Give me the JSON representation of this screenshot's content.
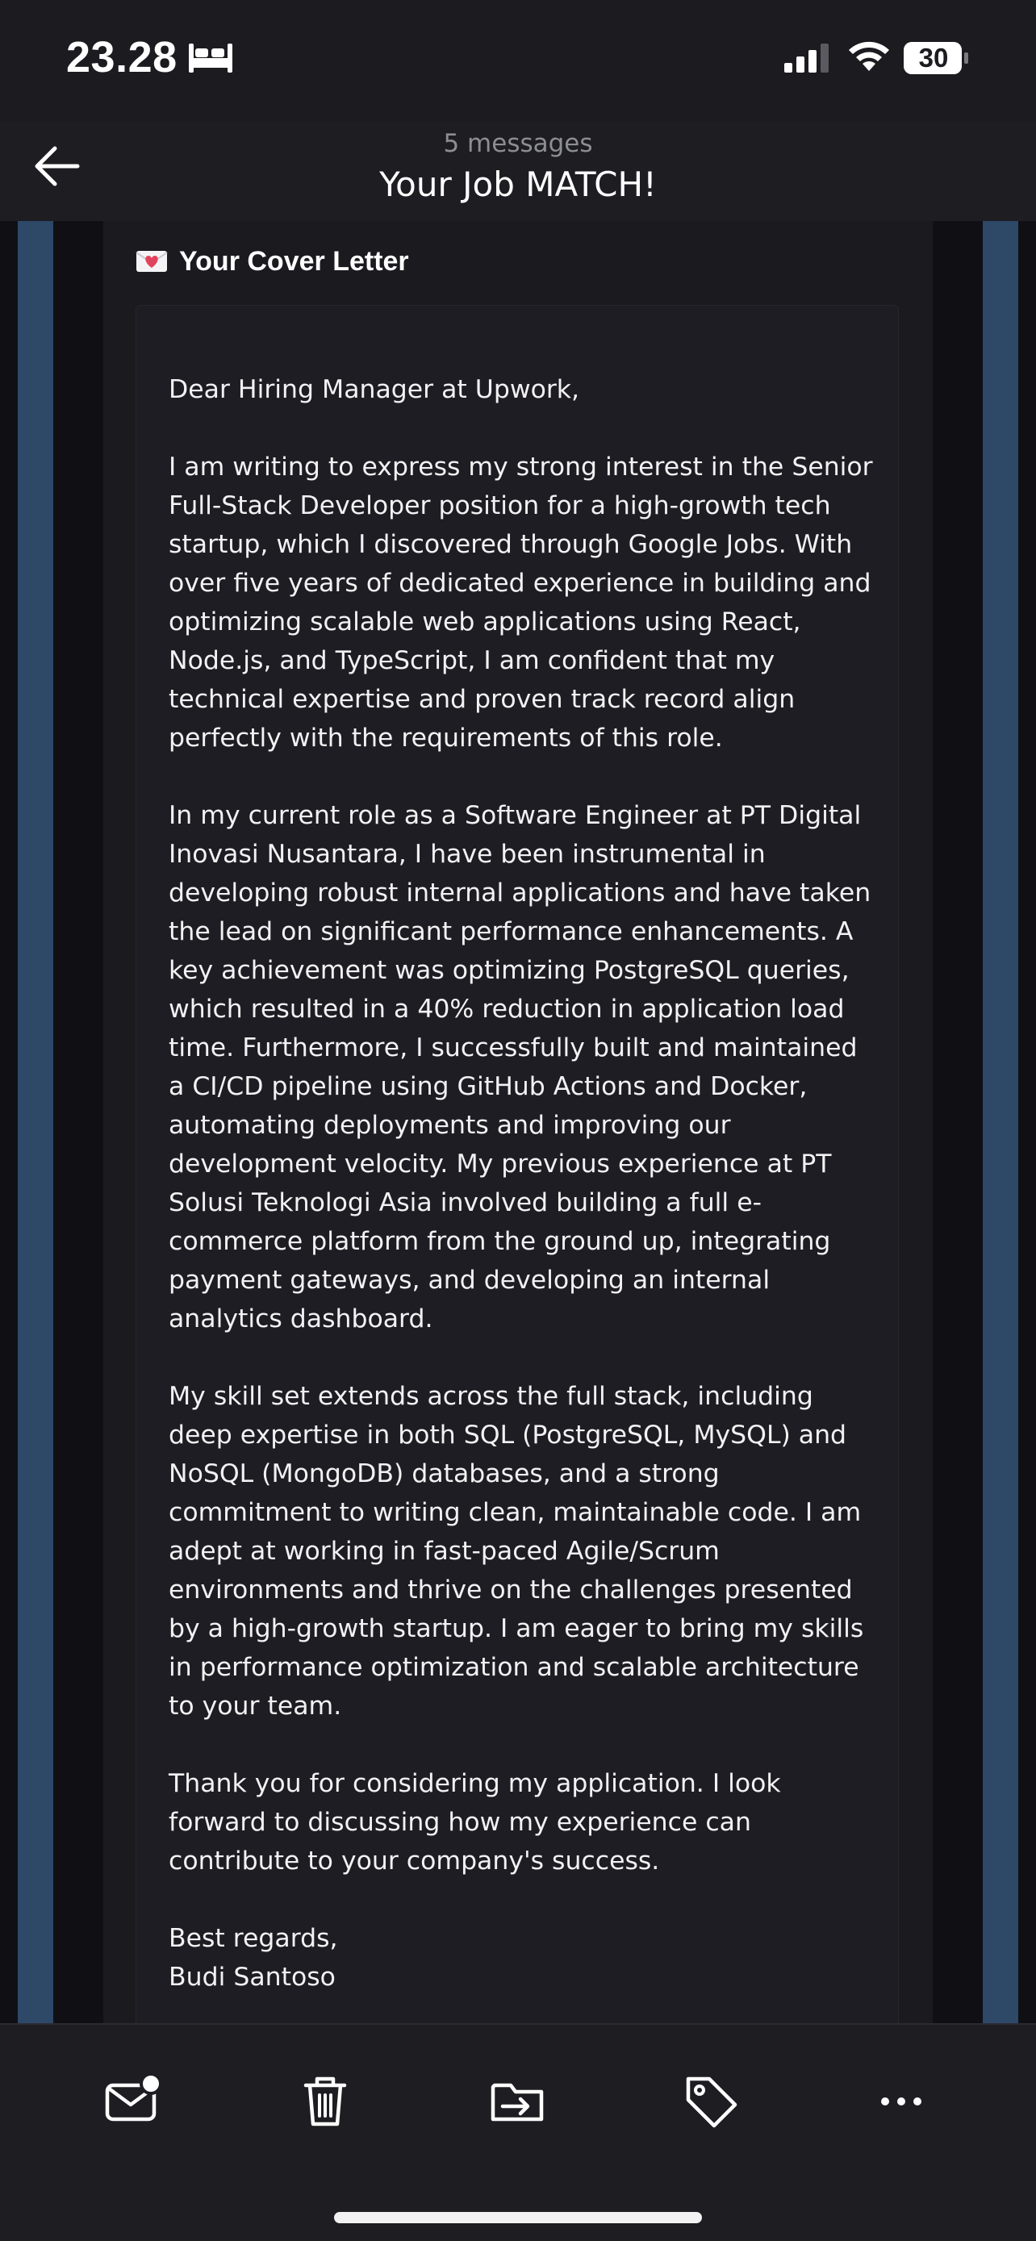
{
  "status_bar": {
    "time": "23.28",
    "battery_level": "30"
  },
  "header": {
    "message_count": "5 messages",
    "title": "Your Job MATCH!"
  },
  "email": {
    "section_heading": "Your Cover Letter",
    "letter_paragraphs": [
      "Dear Hiring Manager at Upwork,",
      "I am writing to express my strong interest in the Senior Full-Stack Developer position for a high-growth tech startup, which I discovered through Google Jobs. With over five years of dedicated experience in building and optimizing scalable web applications using React, Node.js, and TypeScript, I am confident that my technical expertise and proven track record align perfectly with the requirements of this role.",
      "In my current role as a Software Engineer at PT Digital Inovasi Nusantara, I have been instrumental in developing robust internal applications and have taken the lead on significant performance enhancements. A key achievement was optimizing PostgreSQL queries, which resulted in a 40% reduction in application load time. Furthermore, I successfully built and maintained a CI/CD pipeline using GitHub Actions and Docker, automating deployments and improving our development velocity. My previous experience at PT Solusi Teknologi Asia involved building a full e-commerce platform from the ground up, integrating payment gateways, and developing an internal analytics dashboard.",
      "My skill set extends across the full stack, including deep expertise in both SQL (PostgreSQL, MySQL) and NoSQL (MongoDB) databases, and a strong commitment to writing clean, maintainable code. I am adept at working in fast-paced Agile/Scrum environments and thrive on the challenges presented by a high-growth startup. I am eager to bring my skills in performance optimization and scalable architecture to your team.",
      "Thank you for considering my application. I look forward to discussing how my experience can contribute to your company's success.",
      "Best regards,",
      "Budi Santoso"
    ]
  },
  "toolbar": {
    "icons": [
      "mail-unread-icon",
      "trash-icon",
      "move-to-folder-icon",
      "tag-icon",
      "more-icon"
    ]
  },
  "colors": {
    "background": "#1b1b20",
    "accent_strip": "#2e4868",
    "text": "#f2f2f4",
    "muted_text": "#8d8d94",
    "heart": "#e0445c"
  }
}
